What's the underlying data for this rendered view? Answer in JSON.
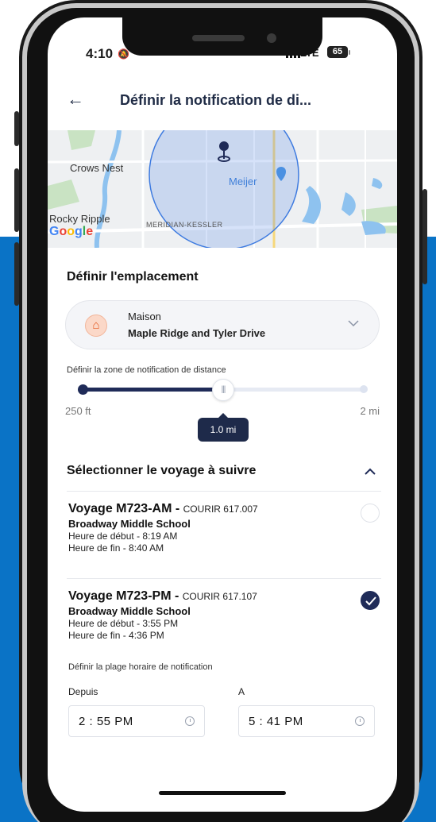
{
  "status_bar": {
    "time": "4:10",
    "network": "LTE",
    "battery": "65"
  },
  "header": {
    "back_icon": "arrow-left-icon",
    "title": "Définir la notification de di..."
  },
  "map": {
    "labels": [
      "Crows Nest",
      "Meijer",
      "Rocky Ripple",
      "MERIDIAN-KESSLER"
    ],
    "attribution": "Google"
  },
  "location": {
    "section_title": "Définir l'emplacement",
    "name": "Maison",
    "address": "Maple Ridge and Tyler Drive"
  },
  "distance": {
    "label": "Définir la zone de notification de distance",
    "min_label": "250 ft",
    "max_label": "2 mi",
    "value_label": "1.0 mi",
    "fraction": 0.5
  },
  "trips": {
    "section_title": "Sélectionner le voyage à suivre",
    "items": [
      {
        "title": "Voyage M723-AM",
        "separator": "-",
        "courier": "COURIR 617.007",
        "school": "Broadway Middle School",
        "start": "Heure de début - 8:19 AM",
        "end": "Heure de fin - 8:40 AM",
        "selected": false
      },
      {
        "title": "Voyage M723-PM",
        "separator": "-",
        "courier": "COURIR 617.107",
        "school": "Broadway Middle School",
        "start": "Heure de début - 3:55 PM",
        "end": "Heure de fin - 4:36 PM",
        "selected": true
      }
    ]
  },
  "time_range": {
    "title": "Définir la plage horaire de notification",
    "from_label": "Depuis",
    "from_value": "2 : 55 PM",
    "to_label": "A",
    "to_value": "5 : 41 PM"
  },
  "colors": {
    "accent": "#1f2b58",
    "background_blue": "#0a73c6",
    "home_icon": "#e4571f"
  }
}
